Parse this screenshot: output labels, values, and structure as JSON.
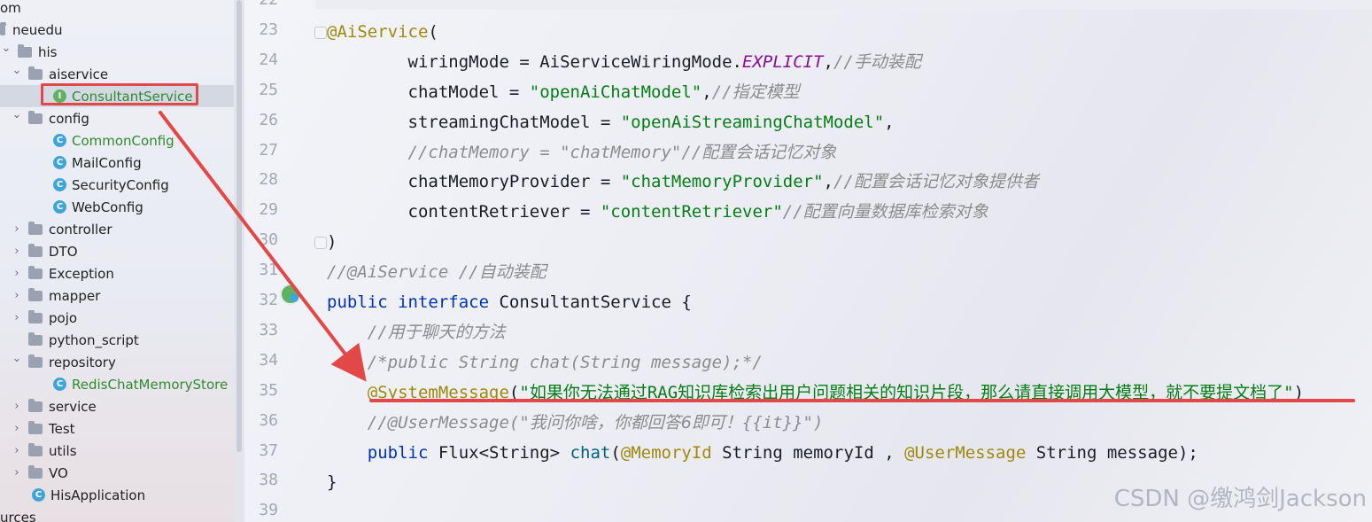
{
  "tree": {
    "items": [
      {
        "label": "om",
        "kind": "text",
        "indent": 0
      },
      {
        "label": "neuedu",
        "kind": "folder-plain",
        "indent": 0
      },
      {
        "label": "his",
        "kind": "folder",
        "indent": 1,
        "expanded": true
      },
      {
        "label": "aiservice",
        "kind": "folder",
        "indent": 2,
        "expanded": true
      },
      {
        "label": "ConsultantService",
        "kind": "interface",
        "indent": 3,
        "selected": true
      },
      {
        "label": "config",
        "kind": "folder",
        "indent": 2,
        "expanded": true
      },
      {
        "label": "CommonConfig",
        "kind": "class",
        "indent": 3,
        "modified": true
      },
      {
        "label": "MailConfig",
        "kind": "class",
        "indent": 3
      },
      {
        "label": "SecurityConfig",
        "kind": "class",
        "indent": 3
      },
      {
        "label": "WebConfig",
        "kind": "class",
        "indent": 3
      },
      {
        "label": "controller",
        "kind": "folder",
        "indent": 2,
        "expanded": false
      },
      {
        "label": "DTO",
        "kind": "folder",
        "indent": 2,
        "expanded": false
      },
      {
        "label": "Exception",
        "kind": "folder",
        "indent": 2,
        "expanded": false
      },
      {
        "label": "mapper",
        "kind": "folder",
        "indent": 2,
        "expanded": false
      },
      {
        "label": "pojo",
        "kind": "folder",
        "indent": 2,
        "expanded": false
      },
      {
        "label": "python_script",
        "kind": "folder-nochev",
        "indent": 2
      },
      {
        "label": "repository",
        "kind": "folder",
        "indent": 2,
        "expanded": true
      },
      {
        "label": "RedisChatMemoryStore",
        "kind": "class",
        "indent": 3,
        "modified": true
      },
      {
        "label": "service",
        "kind": "folder",
        "indent": 2,
        "expanded": false
      },
      {
        "label": "Test",
        "kind": "folder",
        "indent": 2,
        "expanded": false
      },
      {
        "label": "utils",
        "kind": "folder",
        "indent": 2,
        "expanded": false
      },
      {
        "label": "VO",
        "kind": "folder",
        "indent": 2,
        "expanded": false
      },
      {
        "label": "HisApplication",
        "kind": "app",
        "indent": 2
      },
      {
        "label": "urces",
        "kind": "text",
        "indent": 0
      }
    ]
  },
  "editor": {
    "line_numbers": [
      "22",
      "23",
      "24",
      "25",
      "26",
      "27",
      "28",
      "29",
      "30",
      "31",
      "32",
      "33",
      "34",
      "35",
      "36",
      "37",
      "38",
      "39"
    ],
    "lines": [
      [],
      [
        {
          "t": "@AiService",
          "c": "ann"
        },
        {
          "t": "(",
          "c": ""
        }
      ],
      [
        {
          "t": "        wiringMode = AiServiceWiringMode.",
          "c": ""
        },
        {
          "t": "EXPLICIT",
          "c": "const"
        },
        {
          "t": ",",
          "c": ""
        },
        {
          "t": "//",
          "c": "cmt"
        },
        {
          "t": "手动装配",
          "c": "cmt-cjk"
        }
      ],
      [
        {
          "t": "        chatModel = ",
          "c": ""
        },
        {
          "t": "\"openAiChatModel\"",
          "c": "str"
        },
        {
          "t": ",",
          "c": ""
        },
        {
          "t": "//",
          "c": "cmt"
        },
        {
          "t": "指定模型",
          "c": "cmt-cjk"
        }
      ],
      [
        {
          "t": "        streamingChatModel = ",
          "c": ""
        },
        {
          "t": "\"openAiStreamingChatModel\"",
          "c": "str"
        },
        {
          "t": ",",
          "c": ""
        }
      ],
      [
        {
          "t": "        //chatMemory = \"chatMemory\"//",
          "c": "cmt"
        },
        {
          "t": "配置会话记忆对象",
          "c": "cmt-cjk"
        }
      ],
      [
        {
          "t": "        chatMemoryProvider = ",
          "c": ""
        },
        {
          "t": "\"chatMemoryProvider\"",
          "c": "str"
        },
        {
          "t": ",",
          "c": ""
        },
        {
          "t": "//",
          "c": "cmt"
        },
        {
          "t": "配置会话记忆对象提供者",
          "c": "cmt-cjk"
        }
      ],
      [
        {
          "t": "        contentRetriever = ",
          "c": ""
        },
        {
          "t": "\"contentRetriever\"",
          "c": "str"
        },
        {
          "t": "//",
          "c": "cmt"
        },
        {
          "t": "配置向量数据库检索对象",
          "c": "cmt-cjk"
        }
      ],
      [
        {
          "t": ")",
          "c": ""
        }
      ],
      [
        {
          "t": "//@AiService //",
          "c": "cmt"
        },
        {
          "t": "自动装配",
          "c": "cmt-cjk"
        }
      ],
      [
        {
          "t": "public interface ",
          "c": "kw"
        },
        {
          "t": "ConsultantService {",
          "c": ""
        }
      ],
      [
        {
          "t": "    //",
          "c": "cmt"
        },
        {
          "t": "用于聊天的方法",
          "c": "cmt-cjk"
        }
      ],
      [
        {
          "t": "    /*public String chat(String message);*/",
          "c": "cmt"
        }
      ],
      [
        {
          "t": "    ",
          "c": ""
        },
        {
          "t": "@SystemMessage",
          "c": "ann"
        },
        {
          "t": "(",
          "c": ""
        },
        {
          "t": "\"如果你无法通过RAG知识库检索出用户问题相关的知识片段，那么请直接调用大模型，就不要提文档了\"",
          "c": "str"
        },
        {
          "t": ")",
          "c": ""
        }
      ],
      [
        {
          "t": "    //@UserMessage(\"",
          "c": "cmt"
        },
        {
          "t": "我问你啥，你都回答6即可！",
          "c": "cmt-cjk"
        },
        {
          "t": "{{it}}\")",
          "c": "cmt"
        }
      ],
      [
        {
          "t": "    ",
          "c": ""
        },
        {
          "t": "public ",
          "c": "kw"
        },
        {
          "t": "Flux<String> ",
          "c": ""
        },
        {
          "t": "chat",
          "c": "meth"
        },
        {
          "t": "(",
          "c": ""
        },
        {
          "t": "@MemoryId ",
          "c": "ann"
        },
        {
          "t": "String memoryId , ",
          "c": ""
        },
        {
          "t": "@UserMessage ",
          "c": "ann"
        },
        {
          "t": "String message);",
          "c": ""
        }
      ],
      [
        {
          "t": "}",
          "c": ""
        }
      ],
      []
    ]
  },
  "watermark": "CSDN @缴鸿剑Jackson",
  "colors": {
    "annotation": "#9e880d",
    "keyword": "#0033b3",
    "string": "#067d17",
    "comment": "#8c8c8c",
    "highlight_red": "#e34848"
  }
}
